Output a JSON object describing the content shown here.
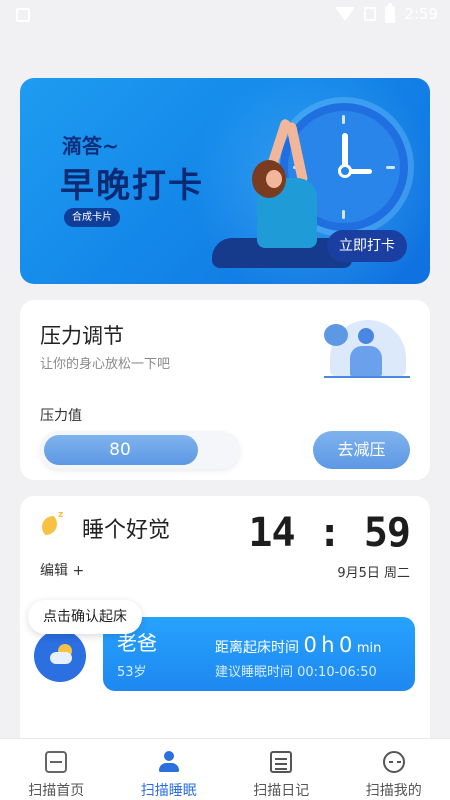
{
  "status_bar": {
    "time": "2:59"
  },
  "banner": {
    "small_text": "滴答~",
    "title": "早晚打卡",
    "chip_label": "合成卡片",
    "button_label": "立即打卡"
  },
  "stress": {
    "title": "压力调节",
    "subtitle": "让你的身心放松一下吧",
    "value_label": "压力值",
    "value": "80",
    "level_fraction": 0.8,
    "button_label": "去减压"
  },
  "sleep": {
    "title": "睡个好觉",
    "time": "14 : 59",
    "date": "9月5日 周二",
    "edit_label": "编辑 +",
    "tooltip": "点击确认起床",
    "person": {
      "name": "老爸",
      "age": "53岁",
      "distance_label": "距离起床时间",
      "hours_value": "0",
      "hours_unit": "h",
      "minutes_value": "0",
      "minutes_unit": "min",
      "recommend": "建议睡眠时间 00:10-06:50"
    }
  },
  "tabs": [
    {
      "label": "扫描首页",
      "icon": "scan-icon",
      "active": false
    },
    {
      "label": "扫描睡眠",
      "icon": "user-icon",
      "active": true
    },
    {
      "label": "扫描日记",
      "icon": "document-icon",
      "active": false
    },
    {
      "label": "扫描我的",
      "icon": "face-icon",
      "active": false
    }
  ],
  "colors": {
    "accent": "#2b6fe0",
    "banner": "#1488ea",
    "button": "#5d98e4"
  }
}
